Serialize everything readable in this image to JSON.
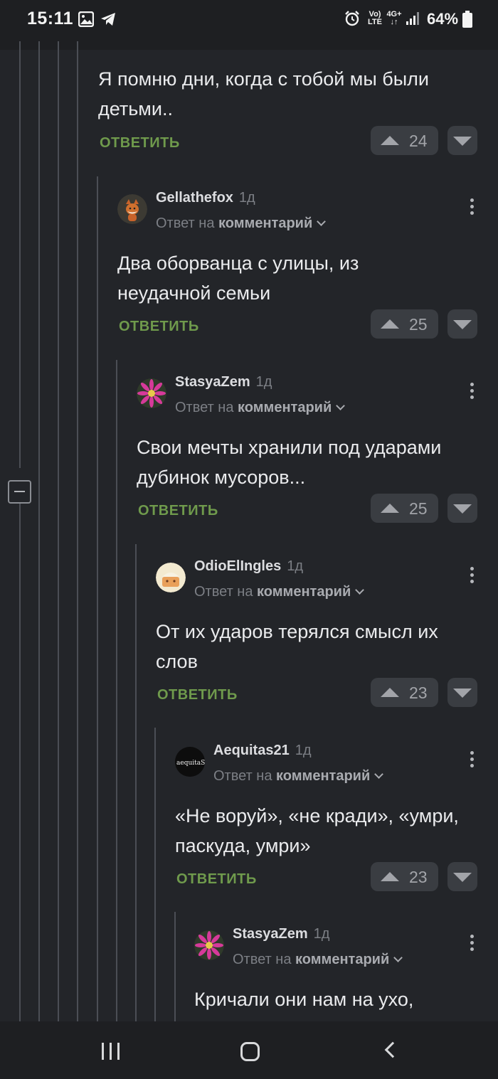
{
  "status_bar": {
    "time": "15:11",
    "network_top": "Vo)",
    "network_bottom": "LTE",
    "data_top": "4G+",
    "data_bottom": "↓↑",
    "battery": "64%"
  },
  "top_comment": {
    "text": "Я помню дни, когда с тобой мы были детьми..",
    "reply_label": "ОТВЕТИТЬ",
    "votes": "24"
  },
  "comments": [
    {
      "author": "Gellathefox",
      "time": "1д",
      "reply_prefix": "Ответ на",
      "reply_target": "комментарий",
      "text": "Два оборванца с улицы, из неудачной семьи",
      "reply_label": "ОТВЕТИТЬ",
      "votes": "25",
      "avatar": "fox-avatar"
    },
    {
      "author": "StasyaZem",
      "time": "1д",
      "reply_prefix": "Ответ на",
      "reply_target": "комментарий",
      "text": "Свои мечты хранили под ударами дубинок мусоров...",
      "reply_label": "ОТВЕТИТЬ",
      "votes": "25",
      "avatar": "flower-avatar"
    },
    {
      "author": "OdioElIngles",
      "time": "1д",
      "reply_prefix": "Ответ на",
      "reply_target": "комментарий",
      "text": "От их ударов терялся смысл их слов",
      "reply_label": "ОТВЕТИТЬ",
      "votes": "23",
      "avatar": "cartoon-avatar"
    },
    {
      "author": "Aequitas21",
      "time": "1д",
      "reply_prefix": "Ответ на",
      "reply_target": "комментарий",
      "text": "«Не воруй», «не кради», «умри, паскуда, умри»",
      "reply_label": "ОТВЕТИТЬ",
      "votes": "23",
      "avatar": "aequitas-logo-avatar",
      "avatar_text": "aequitaS"
    },
    {
      "author": "StasyaZem",
      "time": "1д",
      "reply_prefix": "Ответ на",
      "reply_target": "комментарий",
      "text": "Кричали они нам на ухо,",
      "avatar": "flower-avatar"
    }
  ],
  "colors": {
    "background": "#232529",
    "reply_link": "#6f9a4c",
    "vote_bg": "#3a3d42"
  }
}
